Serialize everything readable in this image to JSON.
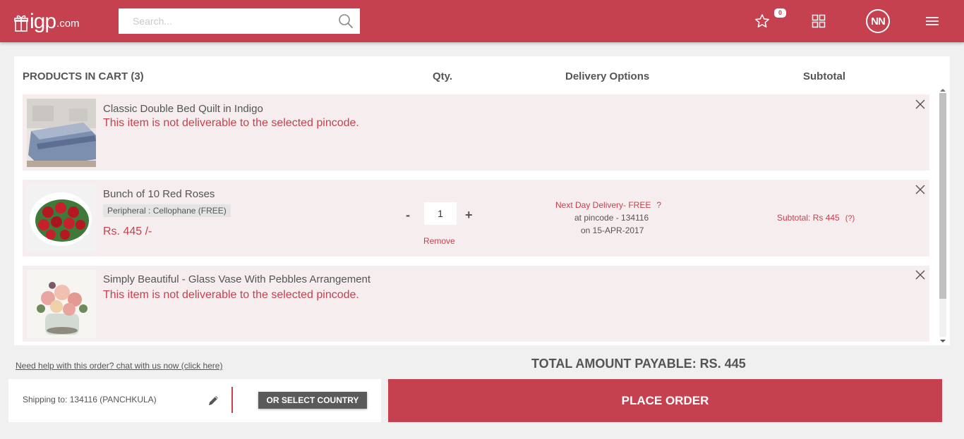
{
  "header": {
    "logo_brand": "igp",
    "logo_suffix": ".com",
    "search_placeholder": "Search...",
    "wishlist_count": "0",
    "avatar_initials": "NN"
  },
  "cart": {
    "col_products": "PRODUCTS IN CART (3)",
    "col_qty": "Qty.",
    "col_delivery": "Delivery Options",
    "col_subtotal": "Subtotal",
    "items": [
      {
        "name": "Classic Double Bed Quilt in Indigo",
        "error": "This item is not deliverable to the selected pincode."
      },
      {
        "name": "Bunch of 10 Red Roses",
        "peripheral": "Peripheral : Cellophane (FREE)",
        "price": "Rs. 445 /-",
        "qty_minus": "-",
        "qty_value": "1",
        "qty_plus": "+",
        "remove_label": "Remove",
        "delivery_line1": "Next Day Delivery- FREE",
        "delivery_help": "?",
        "delivery_line2": "at pincode - 134116",
        "delivery_line3": "on 15-APR-2017",
        "subtotal": "Subtotal: Rs 445",
        "subtotal_help": "(?)"
      },
      {
        "name": "Simply Beautiful - Glass Vase With Pebbles Arrangement",
        "error": "This item is not deliverable to the selected pincode."
      }
    ]
  },
  "footer": {
    "help_link": "Need help with this order? chat with us now (click here)",
    "total": "TOTAL AMOUNT PAYABLE: RS. 445",
    "shipping": "Shipping to: 134116 (PANCHKULA)",
    "select_country": "OR SELECT COUNTRY",
    "place_order": "PLACE ORDER"
  },
  "colors": {
    "brand": "#c5414f",
    "item_bg": "#f6eeee",
    "dark_button": "#5a5a5a"
  },
  "icons": [
    "gift-logo-icon",
    "search-icon",
    "star-icon",
    "grid-icon",
    "menu-icon",
    "close-icon",
    "pencil-icon",
    "scroll-up-arrow",
    "scroll-down-arrow"
  ]
}
